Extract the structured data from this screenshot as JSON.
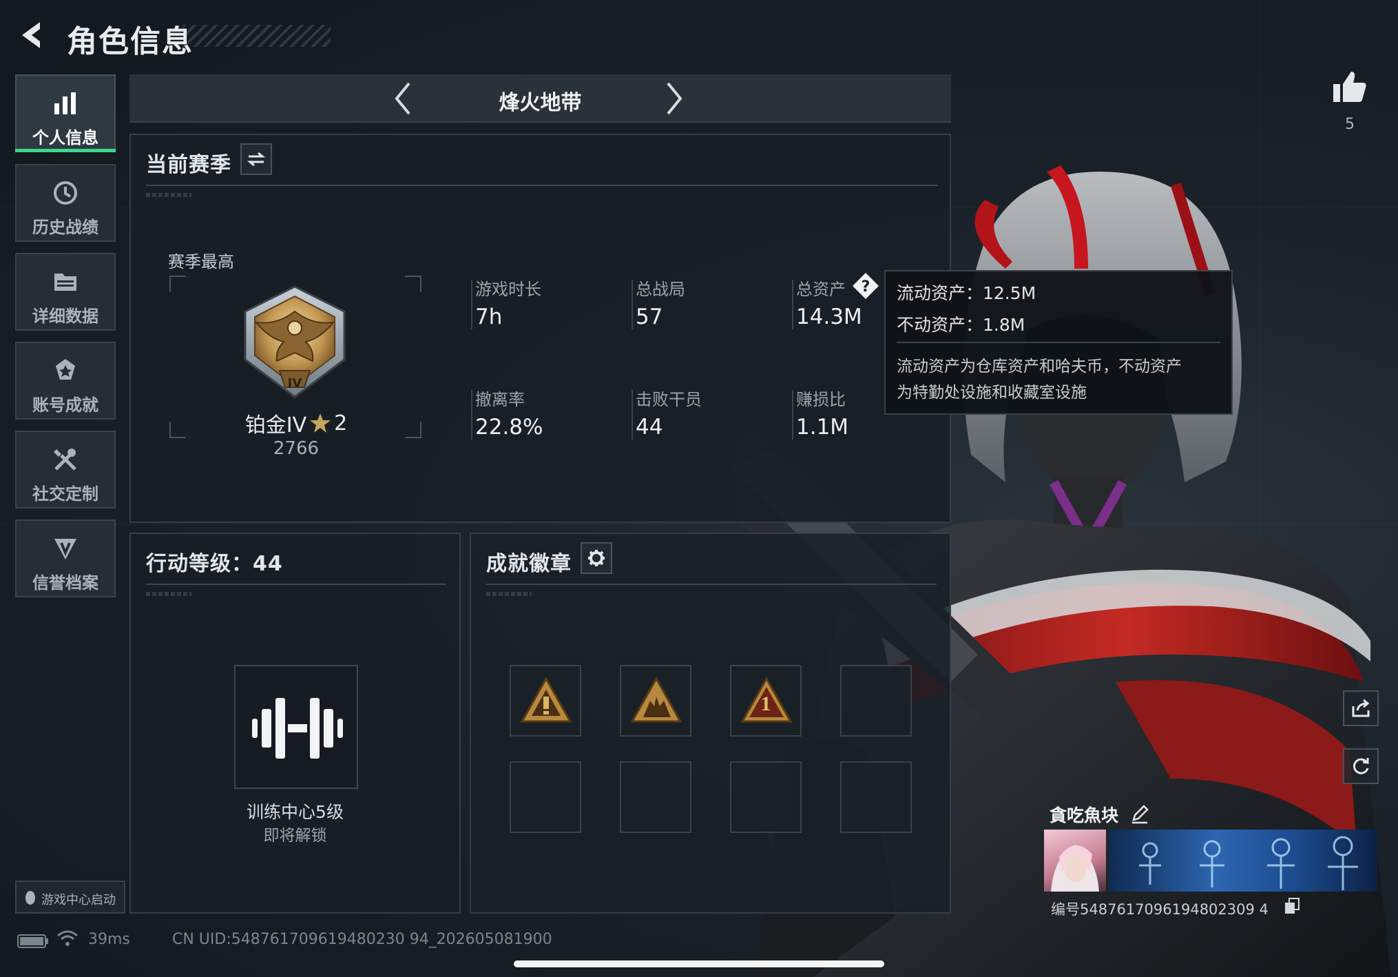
{
  "header": {
    "title": "角色信息"
  },
  "sidebar": {
    "items": [
      {
        "label": "个人信息",
        "icon": "bar-chart-icon",
        "active": true
      },
      {
        "label": "历史战绩",
        "icon": "history-clock-icon"
      },
      {
        "label": "详细数据",
        "icon": "folder-data-icon"
      },
      {
        "label": "账号成就",
        "icon": "achievement-icon"
      },
      {
        "label": "社交定制",
        "icon": "tools-icon"
      },
      {
        "label": "信誉档案",
        "icon": "credit-shield-icon"
      }
    ],
    "launch_label": "游戏中心启动"
  },
  "game_selector": {
    "name": "烽火地带"
  },
  "season": {
    "title": "当前赛季",
    "best_label": "赛季最高",
    "rank_name": "铂金IV",
    "rank_stars": "2",
    "rank_score": "2766",
    "rank_emblem_text": "IV",
    "stats": [
      {
        "label": "游戏时长",
        "value": "7h"
      },
      {
        "label": "总战局",
        "value": "57"
      },
      {
        "label": "总资产",
        "value": "14.3M"
      },
      {
        "label": "撤离率",
        "value": "22.8%"
      },
      {
        "label": "击败干员",
        "value": "44"
      },
      {
        "label": "赚损比",
        "value": "1.1M"
      }
    ]
  },
  "tooltip": {
    "liquid": "流动资产：12.5M",
    "fixed": "不动资产：1.8M",
    "desc_line1": "流动资产为仓库资产和哈夫币，不动资产",
    "desc_line2": "为特勤处设施和收藏室设施"
  },
  "action_level": {
    "title": "行动等级：44",
    "item_name": "训练中心5级",
    "item_status": "即将解锁"
  },
  "badges": {
    "title": "成就徽章",
    "items": [
      "warning-triangle-badge",
      "fighters-triangle-badge",
      "number-one-triangle-badge"
    ],
    "badge_one_text": "1"
  },
  "likes": {
    "count": "5"
  },
  "player": {
    "name": "貪吃魚块",
    "id_text": "编号5487617096194802309 4"
  },
  "status_bar": {
    "ping": "39ms",
    "uid": "CN UID:548761709619480230 94_202605081900"
  },
  "colors": {
    "accent": "#3ed58f",
    "gold": "#c9a35a",
    "panel": "#181f26"
  }
}
